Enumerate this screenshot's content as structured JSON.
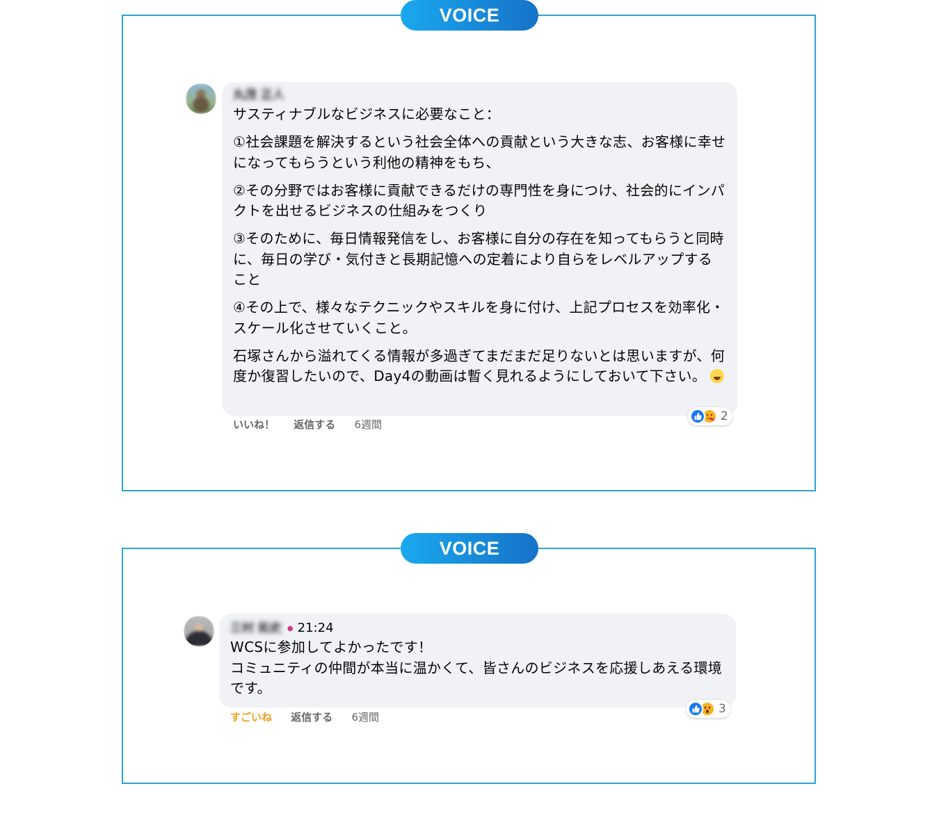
{
  "badges": [
    "VOICE",
    "VOICE"
  ],
  "comments": [
    {
      "author": "丸茂 正人",
      "paragraphs": [
        "サスティナブルなビジネスに必要なこと：",
        "①社会課題を解決するという社会全体への貢献という大きな志、お客様に幸せになってもらうという利他の精神をもち、",
        "②その分野ではお客様に貢献できるだけの専門性を身につけ、社会的にインパクトを出せるビジネスの仕組みをつくり",
        "③そのために、毎日情報発信をし、お客様に自分の存在を知ってもらうと同時に、毎日の学び・気付きと長期記憶への定着により自らをレベルアップすること",
        "④その上で、様々なテクニックやスキルを身に付け、上記プロセスを効率化・スケール化させていくこと。",
        "石塚さんから溢れてくる情報が多過ぎてまだまだ足りないとは思いますが、何度か復習したいので、Day4の動画は暫く見れるようにしておいて下さい。"
      ],
      "actions": {
        "like": "いいね！",
        "reply": "返信する",
        "age": "6週間"
      },
      "reaction_count": "2"
    },
    {
      "author": "三村 拓史",
      "time": "21:24",
      "paragraphs": [
        "WCSに参加してよかったです！",
        "コミュニティの仲間が本当に温かくて、皆さんのビジネスを応援しあえる環境です。"
      ],
      "actions": {
        "like": "すごいね",
        "reply": "返信する",
        "age": "6週間"
      },
      "reaction_count": "3"
    }
  ]
}
